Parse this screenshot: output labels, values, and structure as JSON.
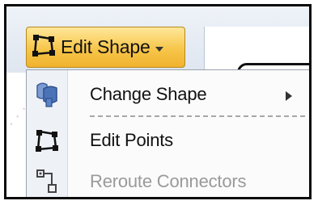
{
  "ribbon": {
    "edit_shape_label": "Edit Shape",
    "edit_shape_icon": "edit-points-icon",
    "dropdown_icon": "dropdown-arrow-icon"
  },
  "menu": {
    "items": [
      {
        "label": "Change Shape",
        "icon": "change-shape-icon",
        "has_submenu": true,
        "enabled": true
      },
      {
        "label": "Edit Points",
        "icon": "edit-points-icon",
        "has_submenu": false,
        "enabled": true
      },
      {
        "label": "Reroute Connectors",
        "icon": "reroute-connectors-icon",
        "has_submenu": false,
        "enabled": false
      }
    ]
  },
  "colors": {
    "button_gold": "#f7c64a",
    "button_border": "#b78a1c",
    "disabled_text": "#9a9a9a",
    "icon_blue": "#4a73b8"
  }
}
